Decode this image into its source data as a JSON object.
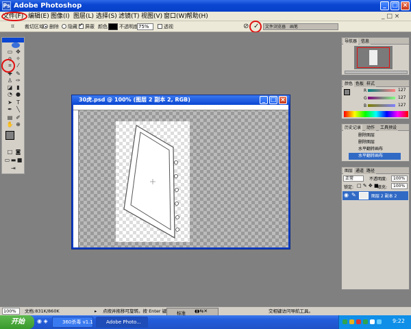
{
  "window": {
    "title": "Adobe Photoshop",
    "logo_text": "Ps"
  },
  "menu": [
    {
      "label": "文件(F)"
    },
    {
      "label": "编辑(E)"
    },
    {
      "label": "图像(I)"
    },
    {
      "label": "图层(L)"
    },
    {
      "label": "选择(S)"
    },
    {
      "label": "滤镜(T)"
    },
    {
      "label": "视图(V)"
    },
    {
      "label": "窗口(W)"
    },
    {
      "label": "帮助(H)"
    }
  ],
  "options": {
    "tool_label": "裁切区域:",
    "delete_label": "删除",
    "hide_label": "隐藏",
    "shield_label": "屏蔽",
    "color_label": "颜色:",
    "opacity_label": "不透明度:",
    "opacity_value": "75%",
    "perspective_label": "透视",
    "palette_well_tab1": "文件浏览器",
    "palette_well_tab2": "画笔"
  },
  "document": {
    "title": "30虎.psd @ 100% (图层 2 副本 2, RGB)"
  },
  "navigator": {
    "tab1": "导航器",
    "tab2": "信息"
  },
  "color_panel": {
    "tab1": "颜色",
    "tab2": "色板",
    "tab3": "样式",
    "r_label": "R",
    "g_label": "G",
    "b_label": "B",
    "r_value": "127",
    "g_value": "127",
    "b_value": "127"
  },
  "history": {
    "tab1": "历史记录",
    "tab2": "动作",
    "tab3": "工具预设",
    "items": [
      {
        "label": "删除图层"
      },
      {
        "label": "删除图层"
      },
      {
        "label": "水平翻转画布"
      },
      {
        "label": "水平翻转画布"
      }
    ]
  },
  "layers": {
    "tab1": "图层",
    "tab2": "通道",
    "tab3": "路径",
    "mode": "正常",
    "opacity_label": "不透明度:",
    "opacity_value": "100%",
    "lock_label": "锁定:",
    "fill_label": "填充:",
    "fill_value": "100%",
    "layer_name": "图层 2 副本 2"
  },
  "status": {
    "zoom": "100%",
    "doc_info": "文档:831K/860K",
    "hint": "点按并拖移可旋转。按 Enter 键提交",
    "imageready_label": "标准",
    "hint_right": "交相键访问导航工具。"
  },
  "taskbar": {
    "start_label": "开始",
    "tasks": [
      {
        "label": "360杀毒 v1.1"
      },
      {
        "label": "Adobe Photo..."
      }
    ],
    "clock": "9:22"
  },
  "colors": {
    "accent_red": "#e01010",
    "title_blue": "#0a46d2",
    "workspace_gray": "#808080"
  }
}
